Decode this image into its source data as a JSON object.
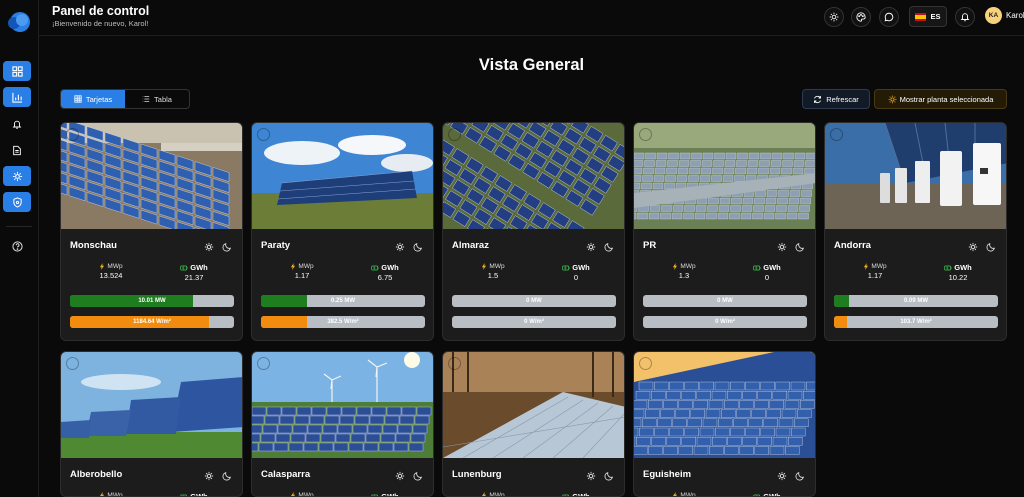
{
  "header": {
    "title": "Panel de control",
    "subtitle": "¡Bienvenido de nuevo, Karol!",
    "language": "ES",
    "avatar_initials": "KA",
    "user_name": "Karol"
  },
  "sidebar": {
    "items": [
      {
        "icon": "grid-icon",
        "active": true
      },
      {
        "icon": "chart-icon",
        "active": true
      },
      {
        "icon": "bell-icon",
        "active": false
      },
      {
        "icon": "document-icon",
        "active": false
      },
      {
        "icon": "settings-icon",
        "active": true
      },
      {
        "icon": "shield-icon",
        "active": true
      },
      {
        "icon": "help-icon",
        "active": false
      }
    ]
  },
  "main": {
    "title": "Vista General",
    "view_cards_label": "Tarjetas",
    "view_table_label": "Tabla",
    "refresh_label": "Refrescar",
    "show_selected_label": "Mostrar planta seleccionada"
  },
  "labels": {
    "mwp": "MWp",
    "gwh": "GWh"
  },
  "colors": {
    "accent": "#2a7fe6",
    "power_bar": "#1e7d1e",
    "irradiance_bar": "#f28c0f",
    "bar_track": "#b8bec4"
  },
  "plants": [
    {
      "name": "Monschau",
      "flag": "colombia",
      "mwp": "13.524",
      "gwh": "21.37",
      "power": "10.01 MW",
      "power_pct": 0.75,
      "irr": "1184.64 W/m²",
      "irr_pct": 0.85
    },
    {
      "name": "Paraty",
      "flag": "germany",
      "mwp": "1.17",
      "gwh": "6.75",
      "power": "0.25 MW",
      "power_pct": 0.28,
      "irr": "382.5 W/m²",
      "irr_pct": 0.28
    },
    {
      "name": "Almaraz",
      "flag": "ecuador",
      "mwp": "1.5",
      "gwh": "0",
      "power": "0 MW",
      "power_pct": 0,
      "irr": "0 W/m²",
      "irr_pct": 0
    },
    {
      "name": "PR",
      "flag": "usa",
      "mwp": "1.3",
      "gwh": "0",
      "power": "0 MW",
      "power_pct": 0,
      "irr": "0 W/m²",
      "irr_pct": 0
    },
    {
      "name": "Andorra",
      "flag": "andorra",
      "mwp": "1.17",
      "gwh": "10.22",
      "power": "0.09 MW",
      "power_pct": 0.09,
      "irr": "103.7 W/m²",
      "irr_pct": 0.08
    },
    {
      "name": "Alberobello",
      "flag": "andorra",
      "mwp": "",
      "gwh": "",
      "power": "",
      "power_pct": 0,
      "irr": "",
      "irr_pct": 0
    },
    {
      "name": "Calasparra",
      "flag": "venezuela",
      "mwp": "",
      "gwh": "",
      "power": "",
      "power_pct": 0,
      "irr": "",
      "irr_pct": 0
    },
    {
      "name": "Lunenburg",
      "flag": "italy",
      "mwp": "",
      "gwh": "",
      "power": "",
      "power_pct": 0,
      "irr": "",
      "irr_pct": 0
    },
    {
      "name": "Eguisheim",
      "flag": "italy",
      "mwp": "",
      "gwh": "",
      "power": "",
      "power_pct": 0,
      "irr": "",
      "irr_pct": 0
    }
  ]
}
